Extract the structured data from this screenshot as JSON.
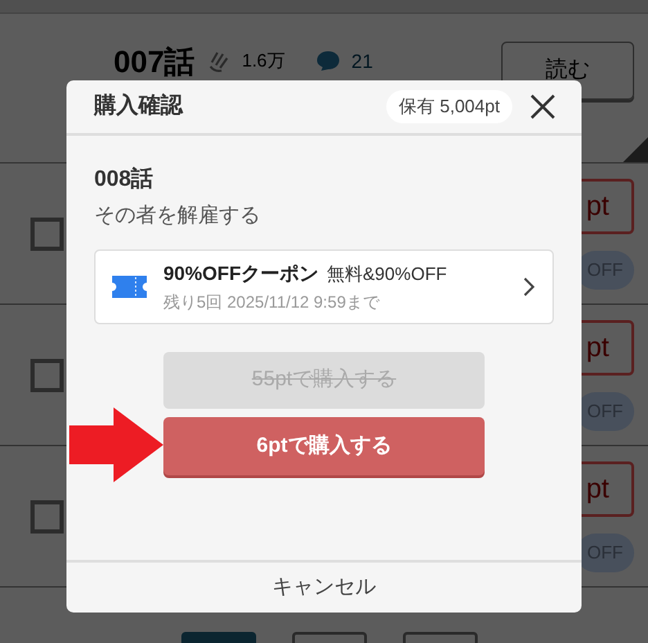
{
  "background": {
    "episode": {
      "title": "007話",
      "claps": "1.6万",
      "comments": "21",
      "read_button": "読む"
    },
    "rows": [
      {
        "checked": false,
        "price_fragment": "pt",
        "discount_fragment": "OFF"
      },
      {
        "checked": false,
        "price_fragment": "pt",
        "discount_fragment": "OFF"
      },
      {
        "checked": false,
        "price_fragment": "pt",
        "discount_fragment": "OFF"
      }
    ]
  },
  "dialog": {
    "title": "購入確認",
    "balance": "保有 5,004pt",
    "episode": "008話",
    "subtitle": "その者を解雇する",
    "coupon": {
      "name": "90%OFFクーポン",
      "benefit": "無料&90%OFF",
      "detail": "残り5回 2025/11/12 9:59まで"
    },
    "buttons": [
      {
        "label": "55ptで購入する",
        "disabled": true
      },
      {
        "label": "6ptで購入する",
        "disabled": false
      }
    ],
    "cancel": "キャンセル"
  }
}
